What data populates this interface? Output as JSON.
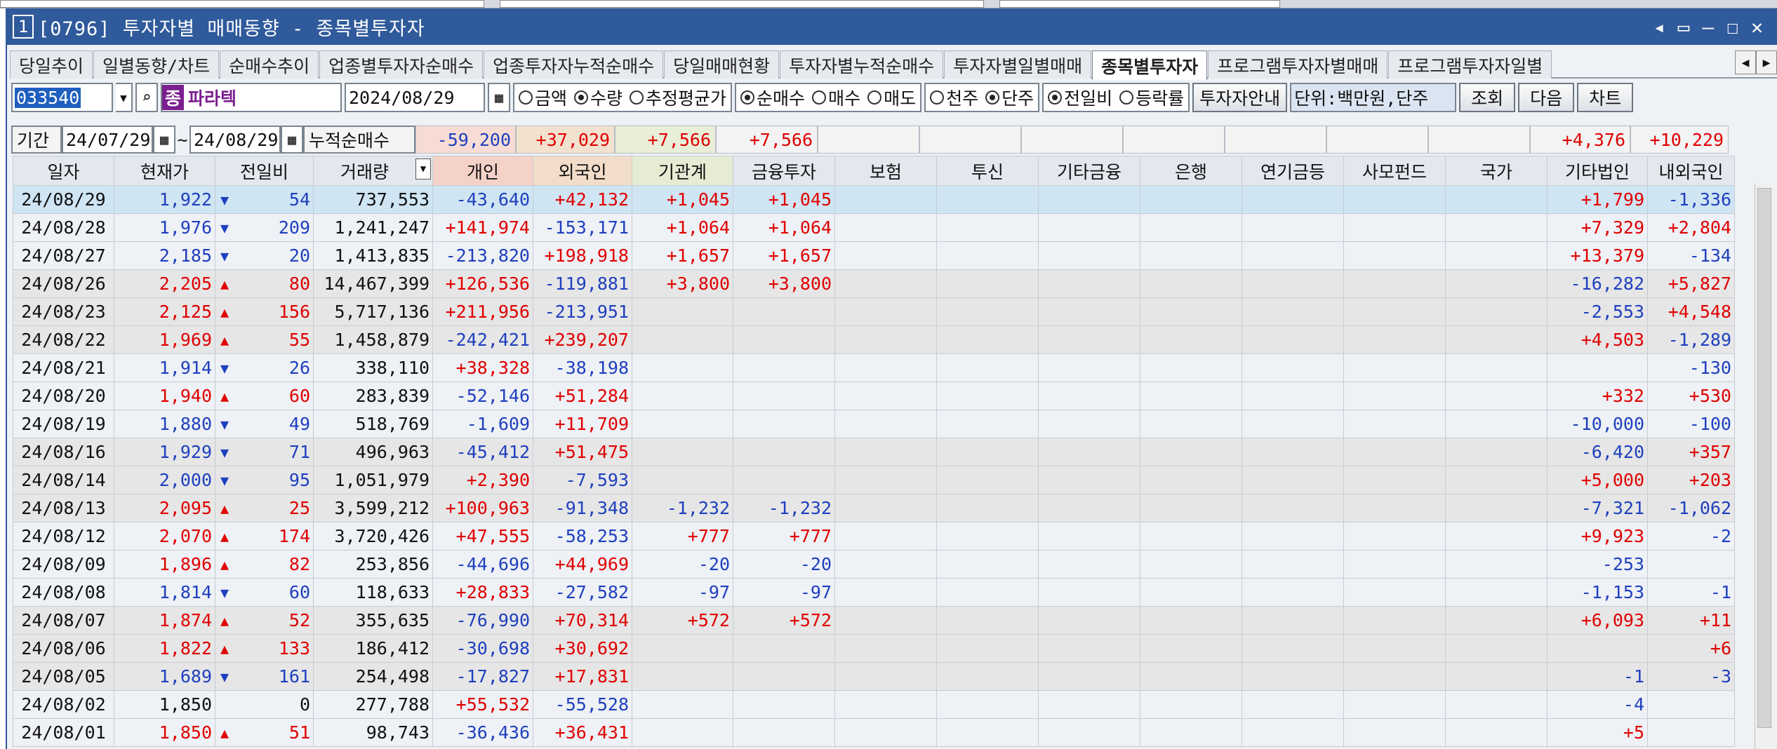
{
  "window": {
    "num": "1",
    "title": "[0796] 투자자별 매매동향 - 종목별투자자",
    "controls": [
      "◂",
      "▭",
      "—",
      "☐",
      "✕"
    ]
  },
  "tabs": [
    "당일추이",
    "일별동향/차트",
    "순매수추이",
    "업종별투자자순매수",
    "업종투자자누적순매수",
    "당일매매현황",
    "투자자별누적순매수",
    "투자자별일별매매",
    "종목별투자자",
    "프로그램투자자별매매",
    "프로그램투자자일별"
  ],
  "active_tab": 8,
  "toolbar": {
    "code": "033540",
    "stock_badge": "종",
    "stock_name": "파라텍",
    "date": "2024/08/29",
    "radio_amount": [
      "금액",
      "수량",
      "추정평균가"
    ],
    "radio_trade": [
      "순매수",
      "매수",
      "매도"
    ],
    "radio_unit": [
      "천주",
      "단주"
    ],
    "radio_compare": [
      "전일비",
      "등락률"
    ],
    "investor_guide": "투자자안내",
    "unit_text": "단위:백만원,단주",
    "query": "조회",
    "next": "다음",
    "chart": "차트"
  },
  "period": {
    "label": "기간",
    "from": "24/07/29",
    "tilde": "~",
    "to": "24/08/29",
    "cumulative_label": "누적순매수",
    "sums": {
      "indiv": "-59,200",
      "foreign": "+37,029",
      "inst": "+7,566",
      "fin": "+7,566",
      "etc": "+4,376",
      "dom": "+10,229"
    }
  },
  "columns": [
    "일자",
    "현재가",
    "전일비",
    "거래량",
    "개인",
    "외국인",
    "기관계",
    "금융투자",
    "보험",
    "투신",
    "기타금융",
    "은행",
    "연기금등",
    "사모펀드",
    "국가",
    "기타법인",
    "내외국인"
  ],
  "rows": [
    {
      "d": "24/08/29",
      "p": "1,922",
      "dir": "dn",
      "diff": "54",
      "vol": "737,553",
      "indiv": "-43,640",
      "fore": "+42,132",
      "inst": "+1,045",
      "fin": "+1,045",
      "etc": "+1,799",
      "dom": "-1,336",
      "cls": "sel"
    },
    {
      "d": "24/08/28",
      "p": "1,976",
      "dir": "dn",
      "diff": "209",
      "vol": "1,241,247",
      "indiv": "+141,974",
      "fore": "-153,171",
      "inst": "+1,064",
      "fin": "+1,064",
      "etc": "+7,329",
      "dom": "+2,804",
      "cls": ""
    },
    {
      "d": "24/08/27",
      "p": "2,185",
      "dir": "dn",
      "diff": "20",
      "vol": "1,413,835",
      "indiv": "-213,820",
      "fore": "+198,918",
      "inst": "+1,657",
      "fin": "+1,657",
      "etc": "+13,379",
      "dom": "-134",
      "cls": ""
    },
    {
      "d": "24/08/26",
      "p": "2,205",
      "dir": "up",
      "diff": "80",
      "vol": "14,467,399",
      "indiv": "+126,536",
      "fore": "-119,881",
      "inst": "+3,800",
      "fin": "+3,800",
      "etc": "-16,282",
      "dom": "+5,827",
      "cls": "grey"
    },
    {
      "d": "24/08/23",
      "p": "2,125",
      "dir": "up",
      "diff": "156",
      "vol": "5,717,136",
      "indiv": "+211,956",
      "fore": "-213,951",
      "inst": "",
      "fin": "",
      "etc": "-2,553",
      "dom": "+4,548",
      "cls": "grey"
    },
    {
      "d": "24/08/22",
      "p": "1,969",
      "dir": "up",
      "diff": "55",
      "vol": "1,458,879",
      "indiv": "-242,421",
      "fore": "+239,207",
      "inst": "",
      "fin": "",
      "etc": "+4,503",
      "dom": "-1,289",
      "cls": "grey"
    },
    {
      "d": "24/08/21",
      "p": "1,914",
      "dir": "dn",
      "diff": "26",
      "vol": "338,110",
      "indiv": "+38,328",
      "fore": "-38,198",
      "inst": "",
      "fin": "",
      "etc": "",
      "dom": "-130",
      "cls": ""
    },
    {
      "d": "24/08/20",
      "p": "1,940",
      "dir": "up",
      "diff": "60",
      "vol": "283,839",
      "indiv": "-52,146",
      "fore": "+51,284",
      "inst": "",
      "fin": "",
      "etc": "+332",
      "dom": "+530",
      "cls": ""
    },
    {
      "d": "24/08/19",
      "p": "1,880",
      "dir": "dn",
      "diff": "49",
      "vol": "518,769",
      "indiv": "-1,609",
      "fore": "+11,709",
      "inst": "",
      "fin": "",
      "etc": "-10,000",
      "dom": "-100",
      "cls": ""
    },
    {
      "d": "24/08/16",
      "p": "1,929",
      "dir": "dn",
      "diff": "71",
      "vol": "496,963",
      "indiv": "-45,412",
      "fore": "+51,475",
      "inst": "",
      "fin": "",
      "etc": "-6,420",
      "dom": "+357",
      "cls": "grey"
    },
    {
      "d": "24/08/14",
      "p": "2,000",
      "dir": "dn",
      "diff": "95",
      "vol": "1,051,979",
      "indiv": "+2,390",
      "fore": "-7,593",
      "inst": "",
      "fin": "",
      "etc": "+5,000",
      "dom": "+203",
      "cls": "grey"
    },
    {
      "d": "24/08/13",
      "p": "2,095",
      "dir": "up",
      "diff": "25",
      "vol": "3,599,212",
      "indiv": "+100,963",
      "fore": "-91,348",
      "inst": "-1,232",
      "fin": "-1,232",
      "etc": "-7,321",
      "dom": "-1,062",
      "cls": "grey"
    },
    {
      "d": "24/08/12",
      "p": "2,070",
      "dir": "up",
      "diff": "174",
      "vol": "3,720,426",
      "indiv": "+47,555",
      "fore": "-58,253",
      "inst": "+777",
      "fin": "+777",
      "etc": "+9,923",
      "dom": "-2",
      "cls": ""
    },
    {
      "d": "24/08/09",
      "p": "1,896",
      "dir": "up",
      "diff": "82",
      "vol": "253,856",
      "indiv": "-44,696",
      "fore": "+44,969",
      "inst": "-20",
      "fin": "-20",
      "etc": "-253",
      "dom": "",
      "cls": ""
    },
    {
      "d": "24/08/08",
      "p": "1,814",
      "dir": "dn",
      "diff": "60",
      "vol": "118,633",
      "indiv": "+28,833",
      "fore": "-27,582",
      "inst": "-97",
      "fin": "-97",
      "etc": "-1,153",
      "dom": "-1",
      "cls": ""
    },
    {
      "d": "24/08/07",
      "p": "1,874",
      "dir": "up",
      "diff": "52",
      "vol": "355,635",
      "indiv": "-76,990",
      "fore": "+70,314",
      "inst": "+572",
      "fin": "+572",
      "etc": "+6,093",
      "dom": "+11",
      "cls": "grey"
    },
    {
      "d": "24/08/06",
      "p": "1,822",
      "dir": "up",
      "diff": "133",
      "vol": "186,412",
      "indiv": "-30,698",
      "fore": "+30,692",
      "inst": "",
      "fin": "",
      "etc": "",
      "dom": "+6",
      "cls": "grey"
    },
    {
      "d": "24/08/05",
      "p": "1,689",
      "dir": "dn",
      "diff": "161",
      "vol": "254,498",
      "indiv": "-17,827",
      "fore": "+17,831",
      "inst": "",
      "fin": "",
      "etc": "-1",
      "dom": "-3",
      "cls": "grey"
    },
    {
      "d": "24/08/02",
      "p": "1,850",
      "dir": "",
      "diff": "0",
      "vol": "277,788",
      "indiv": "+55,532",
      "fore": "-55,528",
      "inst": "",
      "fin": "",
      "etc": "-4",
      "dom": "",
      "cls": ""
    },
    {
      "d": "24/08/01",
      "p": "1,850",
      "dir": "up",
      "diff": "51",
      "vol": "98,743",
      "indiv": "-36,436",
      "fore": "+36,431",
      "inst": "",
      "fin": "",
      "etc": "+5",
      "dom": "",
      "cls": ""
    }
  ]
}
